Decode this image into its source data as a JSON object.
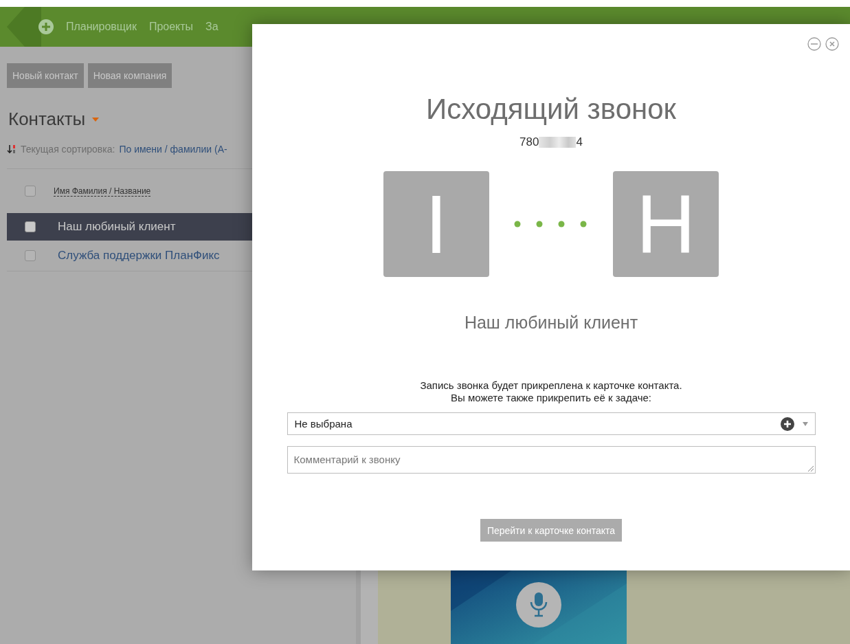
{
  "nav": {
    "items": [
      {
        "label": "Планировщик"
      },
      {
        "label": "Проекты"
      },
      {
        "label": "За"
      }
    ]
  },
  "toolbar": {
    "buttons": [
      "Новый контакт",
      "Новая компания"
    ]
  },
  "contacts": {
    "title": "Контакты",
    "sort_label": "Текущая сортировка:",
    "sort_value": "По имени / фамилии (А-",
    "column": "Имя Фамилия / Название",
    "header_checked": false,
    "rows": [
      {
        "name": "Наш любиный клиент",
        "selected": true,
        "checked": false
      },
      {
        "name": "Служба поддержки ПланФикс",
        "selected": false,
        "checked": false
      }
    ]
  },
  "call_dialog": {
    "title": "Исходящий звонок",
    "phone_start": "780",
    "phone_end": "4",
    "caller_initial": "I",
    "callee_initial": "H",
    "contact_name": "Наш любиный клиент",
    "note_lines": [
      "Запись звонка будет прикреплена к карточке контакта.",
      "Вы можете также прикрепить её к задаче:"
    ],
    "task_select": {
      "value": "Не выбрана"
    },
    "comment": {
      "placeholder": "Комментарий к звонку"
    },
    "button": "Перейти к карточке контакта"
  }
}
